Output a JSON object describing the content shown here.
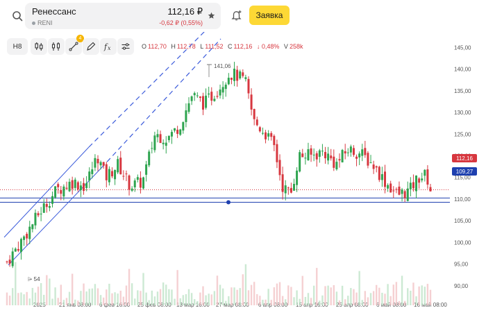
{
  "header": {
    "name": "Ренессанс",
    "ticker": "RENI",
    "price": "112,16 ₽",
    "change": "-0,62 ₽ (0,55%)",
    "order_button": "Заявка"
  },
  "toolbar": {
    "interval": "Н8",
    "drawing_badge": "4",
    "ohlc": {
      "open_label": "O",
      "open": "112,70",
      "high_label": "H",
      "high": "112,78",
      "low_label": "L",
      "low": "111,52",
      "close_label": "C",
      "close": "112,16",
      "change": "↓ 0,48%",
      "volume_label": "V",
      "volume": "258k"
    }
  },
  "icons": {
    "search": "search-icon",
    "star": "star-icon",
    "bell": "bell-plus-icon",
    "candles": "candles-icon",
    "line_tool": "trend-line-icon",
    "brush": "brush-icon",
    "indicators": "fx-icon",
    "settings": "sliders-icon"
  },
  "colors": {
    "up": "#2ea44f",
    "down": "#d7373f",
    "accent": "#fdd835",
    "level": "#1e40af",
    "channel": "#3b5bdb"
  },
  "chart_data": {
    "type": "candlestick",
    "y_axis": [
      "145,00",
      "140,00",
      "135,00",
      "130,00",
      "125,00",
      "120,00",
      "115,00",
      "110,00",
      "105,00",
      "100,00",
      "95,00",
      "90,00"
    ],
    "ylim": [
      89,
      147
    ],
    "x_axis": [
      "2025",
      "21 янв 08:00",
      "6 фев 16:00",
      "25 фев 08:00",
      "13 мар 16:00",
      "27 мар 08:00",
      "6 апр 08:00",
      "15 апр 16:00",
      "25 апр 08:00",
      "6 май 08:00",
      "16 май 08:00"
    ],
    "last_price_label": "112,16",
    "last_price": 112.16,
    "level_label": "109,27",
    "level": 109.27,
    "hidden_level_label": "110,25",
    "hidden_level": 110.25,
    "high_annotation": "141,06",
    "high_value": 141.06,
    "volume_label": "54",
    "close_path": [
      {
        "t": 0,
        "v": 95.5
      },
      {
        "t": 4,
        "v": 101
      },
      {
        "t": 8,
        "v": 107
      },
      {
        "t": 12,
        "v": 112
      },
      {
        "t": 16,
        "v": 114
      },
      {
        "t": 19,
        "v": 113
      },
      {
        "t": 22,
        "v": 120
      },
      {
        "t": 24,
        "v": 115
      },
      {
        "t": 27,
        "v": 118
      },
      {
        "t": 30,
        "v": 113
      },
      {
        "t": 33,
        "v": 114
      },
      {
        "t": 36,
        "v": 125
      },
      {
        "t": 39,
        "v": 124
      },
      {
        "t": 42,
        "v": 127
      },
      {
        "t": 45,
        "v": 134
      },
      {
        "t": 48,
        "v": 132
      },
      {
        "t": 51,
        "v": 135
      },
      {
        "t": 54,
        "v": 139
      },
      {
        "t": 56,
        "v": 138.5
      },
      {
        "t": 58,
        "v": 137
      },
      {
        "t": 60,
        "v": 128
      },
      {
        "t": 63,
        "v": 125
      },
      {
        "t": 65,
        "v": 122
      },
      {
        "t": 67,
        "v": 113
      },
      {
        "t": 69,
        "v": 111
      },
      {
        "t": 71,
        "v": 120
      },
      {
        "t": 74,
        "v": 120
      },
      {
        "t": 77,
        "v": 121
      },
      {
        "t": 80,
        "v": 118
      },
      {
        "t": 83,
        "v": 121.5
      },
      {
        "t": 86,
        "v": 120.5
      },
      {
        "t": 89,
        "v": 118
      },
      {
        "t": 92,
        "v": 114
      },
      {
        "t": 95,
        "v": 111
      },
      {
        "t": 98,
        "v": 112
      },
      {
        "t": 100,
        "v": 115
      },
      {
        "t": 102,
        "v": 115.5
      },
      {
        "t": 103,
        "v": 112.2
      }
    ]
  }
}
